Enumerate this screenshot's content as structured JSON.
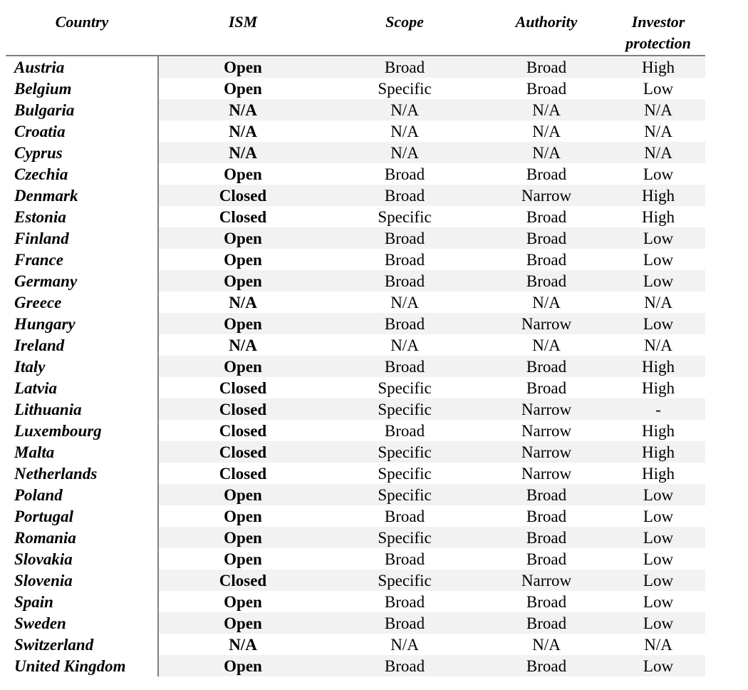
{
  "table": {
    "headers": {
      "country": "Country",
      "ism": "ISM",
      "scope": "Scope",
      "authority": "Authority",
      "investor_protection_line1": "Investor",
      "investor_protection_line2": "protection"
    },
    "rows": [
      {
        "country": "Austria",
        "ism": "Open",
        "scope": "Broad",
        "authority": "Broad",
        "investor_protection": "High"
      },
      {
        "country": "Belgium",
        "ism": "Open",
        "scope": "Specific",
        "authority": "Broad",
        "investor_protection": "Low"
      },
      {
        "country": "Bulgaria",
        "ism": "N/A",
        "scope": "N/A",
        "authority": "N/A",
        "investor_protection": "N/A"
      },
      {
        "country": "Croatia",
        "ism": "N/A",
        "scope": "N/A",
        "authority": "N/A",
        "investor_protection": "N/A"
      },
      {
        "country": "Cyprus",
        "ism": "N/A",
        "scope": "N/A",
        "authority": "N/A",
        "investor_protection": "N/A"
      },
      {
        "country": "Czechia",
        "ism": "Open",
        "scope": "Broad",
        "authority": "Broad",
        "investor_protection": "Low"
      },
      {
        "country": "Denmark",
        "ism": "Closed",
        "scope": "Broad",
        "authority": "Narrow",
        "investor_protection": "High"
      },
      {
        "country": "Estonia",
        "ism": "Closed",
        "scope": "Specific",
        "authority": "Broad",
        "investor_protection": "High"
      },
      {
        "country": "Finland",
        "ism": "Open",
        "scope": "Broad",
        "authority": "Broad",
        "investor_protection": "Low"
      },
      {
        "country": "France",
        "ism": "Open",
        "scope": "Broad",
        "authority": "Broad",
        "investor_protection": "Low"
      },
      {
        "country": "Germany",
        "ism": "Open",
        "scope": "Broad",
        "authority": "Broad",
        "investor_protection": "Low"
      },
      {
        "country": "Greece",
        "ism": "N/A",
        "scope": "N/A",
        "authority": "N/A",
        "investor_protection": "N/A"
      },
      {
        "country": "Hungary",
        "ism": "Open",
        "scope": "Broad",
        "authority": "Narrow",
        "investor_protection": "Low"
      },
      {
        "country": "Ireland",
        "ism": "N/A",
        "scope": "N/A",
        "authority": "N/A",
        "investor_protection": "N/A"
      },
      {
        "country": "Italy",
        "ism": "Open",
        "scope": "Broad",
        "authority": "Broad",
        "investor_protection": "High"
      },
      {
        "country": "Latvia",
        "ism": "Closed",
        "scope": "Specific",
        "authority": "Broad",
        "investor_protection": "High"
      },
      {
        "country": "Lithuania",
        "ism": "Closed",
        "scope": "Specific",
        "authority": "Narrow",
        "investor_protection": "-"
      },
      {
        "country": "Luxembourg",
        "ism": "Closed",
        "scope": "Broad",
        "authority": "Narrow",
        "investor_protection": "High"
      },
      {
        "country": "Malta",
        "ism": "Closed",
        "scope": "Specific",
        "authority": "Narrow",
        "investor_protection": "High"
      },
      {
        "country": "Netherlands",
        "ism": "Closed",
        "scope": "Specific",
        "authority": "Narrow",
        "investor_protection": "High"
      },
      {
        "country": "Poland",
        "ism": "Open",
        "scope": "Specific",
        "authority": "Broad",
        "investor_protection": "Low"
      },
      {
        "country": "Portugal",
        "ism": "Open",
        "scope": "Broad",
        "authority": "Broad",
        "investor_protection": "Low"
      },
      {
        "country": "Romania",
        "ism": "Open",
        "scope": "Specific",
        "authority": "Broad",
        "investor_protection": "Low"
      },
      {
        "country": "Slovakia",
        "ism": "Open",
        "scope": "Broad",
        "authority": "Broad",
        "investor_protection": "Low"
      },
      {
        "country": "Slovenia",
        "ism": "Closed",
        "scope": "Specific",
        "authority": "Narrow",
        "investor_protection": "Low"
      },
      {
        "country": "Spain",
        "ism": "Open",
        "scope": "Broad",
        "authority": "Broad",
        "investor_protection": "Low"
      },
      {
        "country": "Sweden",
        "ism": "Open",
        "scope": "Broad",
        "authority": "Broad",
        "investor_protection": "Low"
      },
      {
        "country": "Switzerland",
        "ism": "N/A",
        "scope": "N/A",
        "authority": "N/A",
        "investor_protection": "N/A"
      },
      {
        "country": "United Kingdom",
        "ism": "Open",
        "scope": "Broad",
        "authority": "Broad",
        "investor_protection": "Low"
      }
    ]
  },
  "colors": {
    "stripe": "#f2f2f2",
    "rule": "#7f7f7f"
  }
}
